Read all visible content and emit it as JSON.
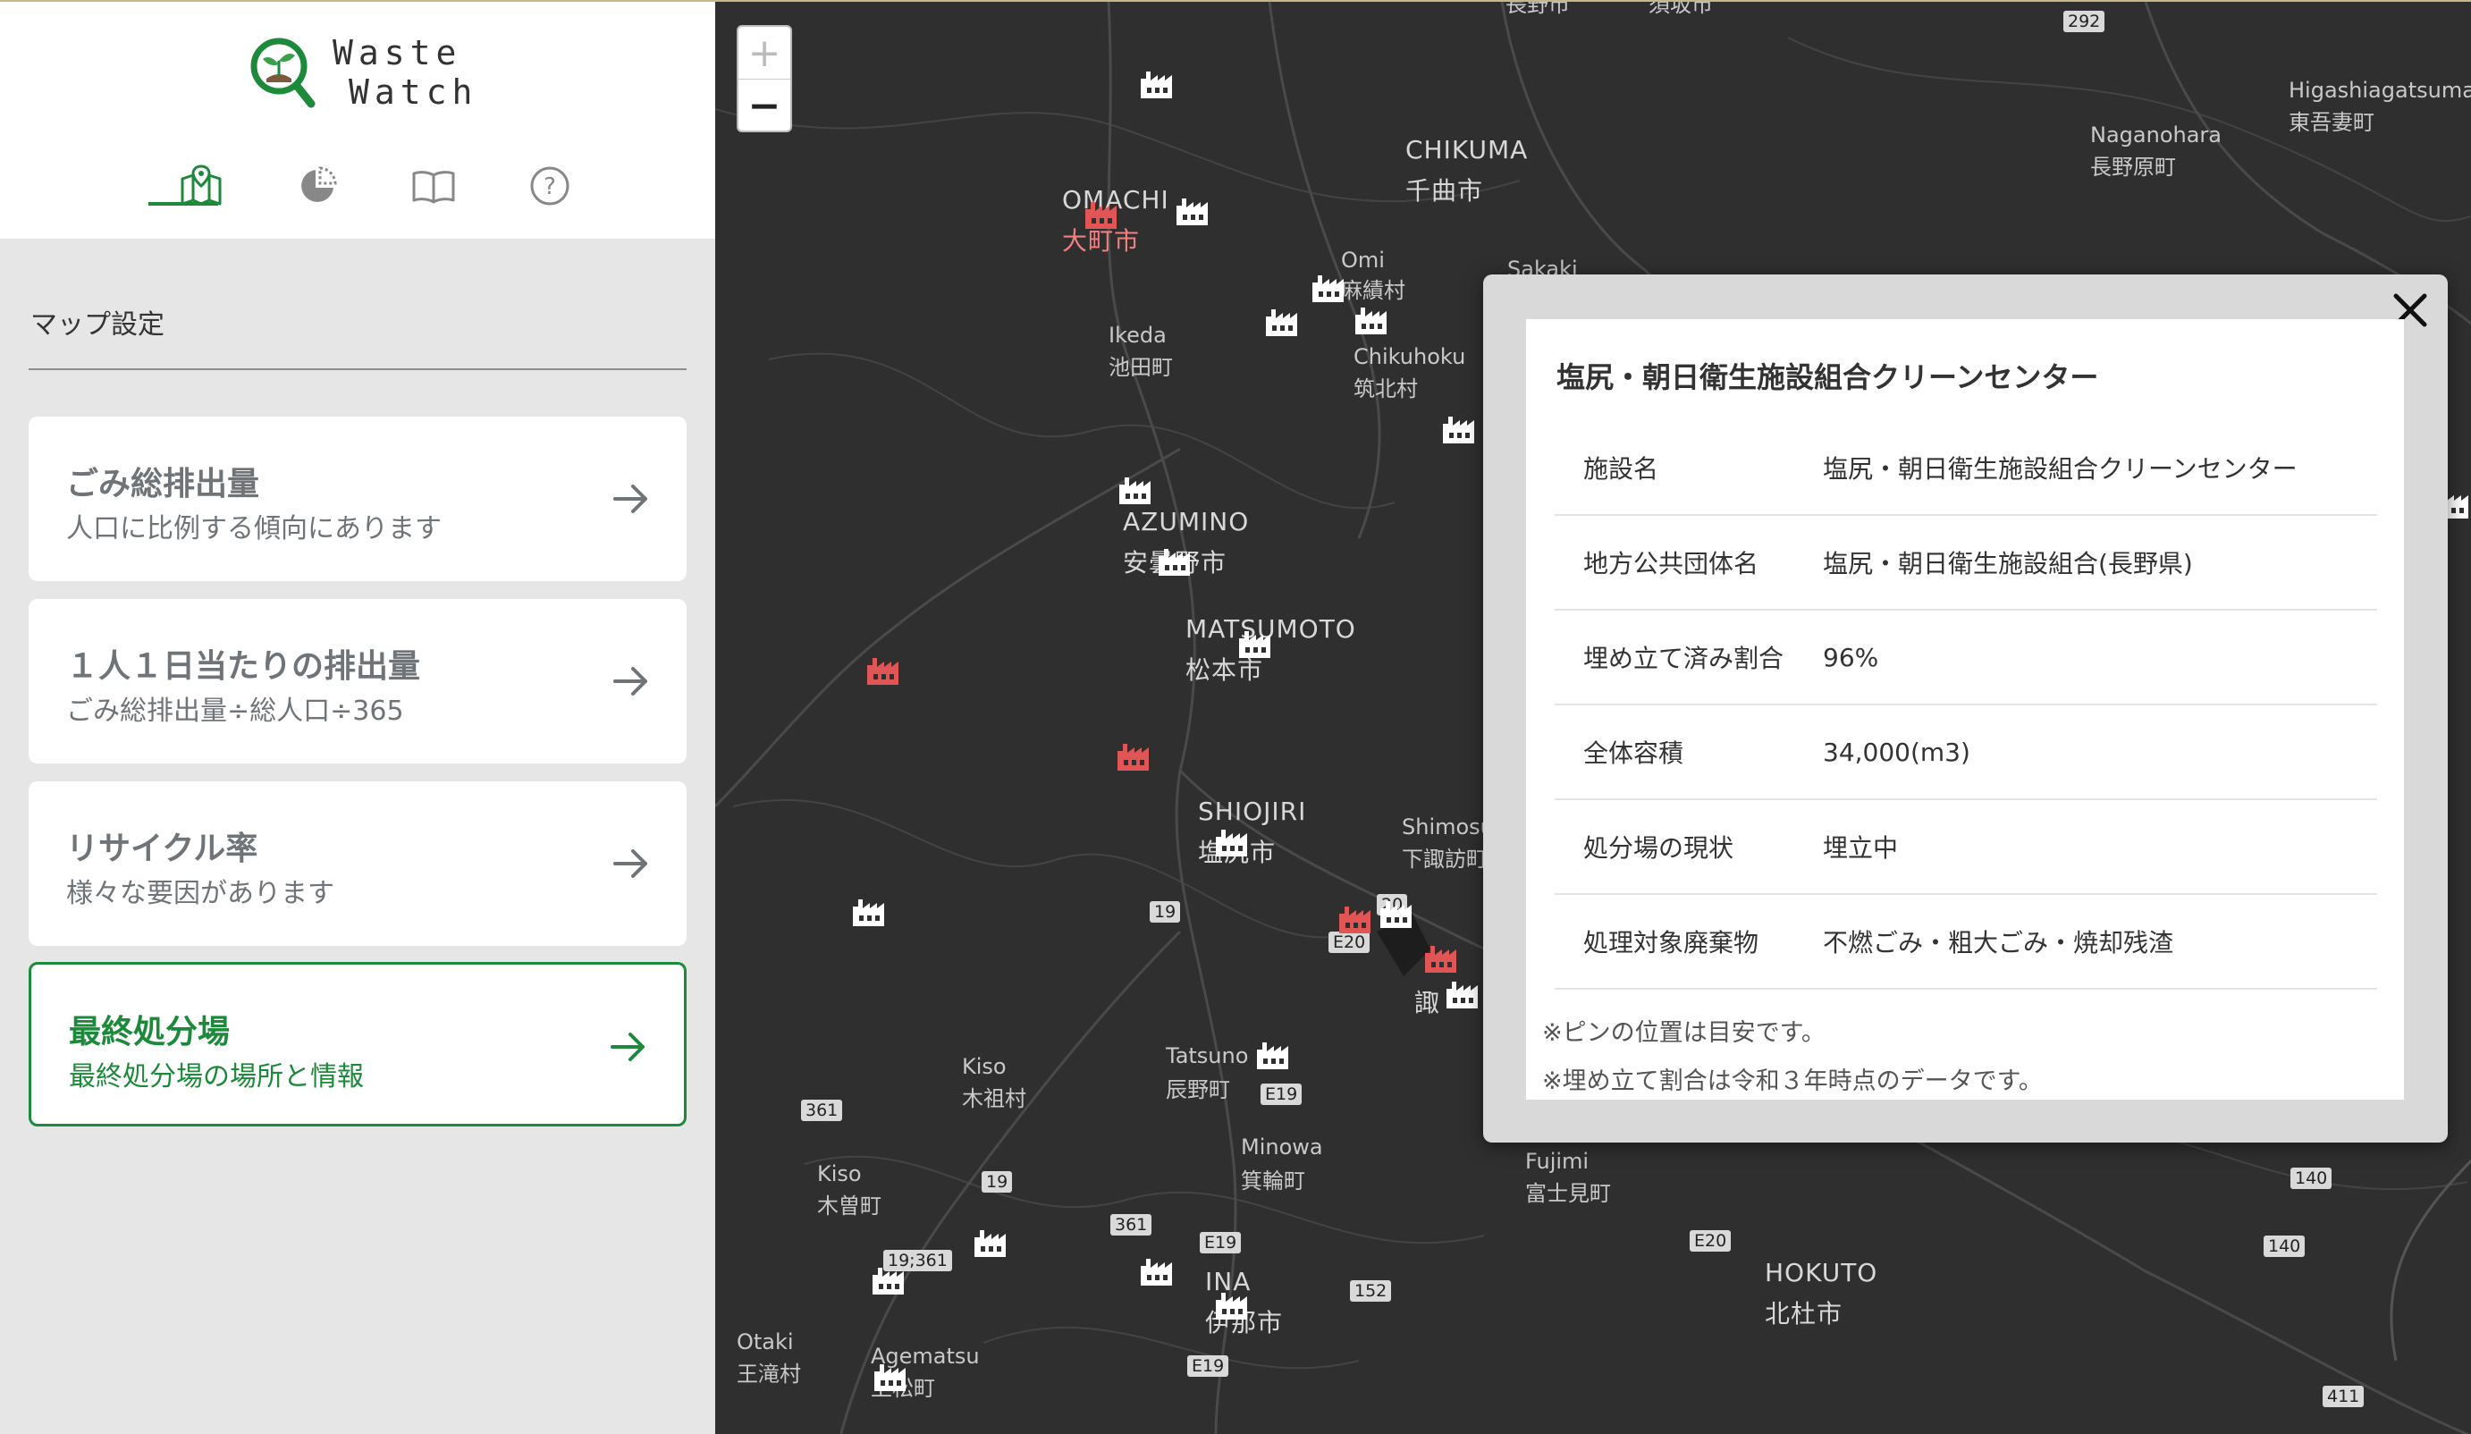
{
  "app": {
    "logo_line1": "Waste",
    "logo_line2": "Watch"
  },
  "tabs": [
    {
      "name": "map",
      "icon": "map-icon",
      "active": true
    },
    {
      "name": "chart",
      "icon": "pie-chart-icon",
      "active": false
    },
    {
      "name": "guide",
      "icon": "book-icon",
      "active": false
    },
    {
      "name": "help",
      "icon": "help-circle-icon",
      "active": false
    }
  ],
  "sidebar": {
    "section_title": "マップ設定",
    "cards": [
      {
        "title": "ごみ総排出量",
        "subtitle": "人口に比例する傾向にあります",
        "active": false
      },
      {
        "title": "１人１日当たりの排出量",
        "subtitle": "ごみ総排出量÷総人口÷365",
        "active": false
      },
      {
        "title": "リサイクル率",
        "subtitle": "様々な要因があります",
        "active": false
      },
      {
        "title": "最終処分場",
        "subtitle": "最終処分場の場所と情報",
        "active": true
      }
    ]
  },
  "map": {
    "zoom_in": "+",
    "zoom_out": "−",
    "labels": {
      "nagano": "長野市",
      "suzaka": "須坂市",
      "chikuma_en": "CHIKUMA",
      "chikuma_ja": "千曲市",
      "omachi_en": "OMACHI",
      "omachi_ja": "大町市",
      "omi_en": "Omi",
      "omi_ja": "麻績村",
      "sakaki": "Sakaki",
      "ikeda_en": "Ikeda",
      "ikeda_ja": "池田町",
      "chikuhoku_en": "Chikuhoku",
      "chikuhoku_ja": "筑北村",
      "azumino_en": "AZUMINO",
      "azumino_ja": "安曇野市",
      "matsumoto_en": "MATSUMOTO",
      "matsumoto_ja": "松本市",
      "shiojiri_en": "SHIOJIRI",
      "shiojiri_ja": "塩尻市",
      "shimosuwa_en": "Shimosu",
      "shimosuwa_ja": "下諏訪町",
      "suwa_ja": "諏",
      "tatsuno_en": "Tatsuno",
      "tatsuno_ja": "辰野町",
      "minowa_en": "Minowa",
      "minowa_ja": "箕輪町",
      "kiso1_en": "Kiso",
      "kiso1_ja": "木祖村",
      "kiso2_en": "Kiso",
      "kiso2_ja": "木曽町",
      "ina_en": "INA",
      "ina_ja": "伊那市",
      "otaki_en": "Otaki",
      "otaki_ja": "王滝村",
      "agematsu_en": "Agematsu",
      "agematsu_ja": "上松町",
      "fujimi_en": "Fujimi",
      "fujimi_ja": "富士見町",
      "hokuto_en": "HOKUTO",
      "hokuto_ja": "北杜市",
      "naganohara_en": "Naganohara",
      "naganohara_ja": "長野原町",
      "higashiagatsuma_en": "Higashiagatsuma",
      "higashiagatsuma_ja": "東吾妻町"
    },
    "roads": [
      "292",
      "19",
      "E20",
      "E19",
      "361",
      "19",
      "361",
      "19;361",
      "E19",
      "152",
      "E19",
      "E20",
      "140",
      "140",
      "411",
      "20"
    ]
  },
  "popup": {
    "title": "塩尻・朝日衛生施設組合クリーンセンター",
    "rows": [
      {
        "key": "施設名",
        "value": "塩尻・朝日衛生施設組合クリーンセンター"
      },
      {
        "key": "地方公共団体名",
        "value": "塩尻・朝日衛生施設組合(長野県)"
      },
      {
        "key": "埋め立て済み割合",
        "value": "96%"
      },
      {
        "key": "全体容積",
        "value": "34,000(m3)"
      },
      {
        "key": "処分場の現状",
        "value": "埋立中"
      },
      {
        "key": "処理対象廃棄物",
        "value": "不燃ごみ・粗大ごみ・焼却残渣"
      }
    ],
    "note1": "※ピンの位置は目安です。",
    "note2": "※埋め立て割合は令和３年時点のデータです。"
  },
  "colors": {
    "accent": "#1c8a3a",
    "pin_normal": "#ffffff",
    "pin_alert": "#e05555",
    "map_bg": "#2f2f2f",
    "sidebar_bg": "#e6e6e6"
  }
}
